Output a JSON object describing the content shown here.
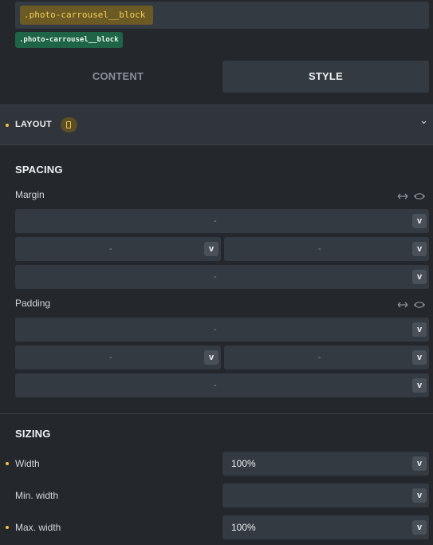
{
  "selector": {
    "chip_label": ".photo-carrousel__block",
    "class_tag": ".photo-carrousel__block"
  },
  "tabs": [
    {
      "label": "CONTENT",
      "active": false
    },
    {
      "label": "STYLE",
      "active": true
    }
  ],
  "layout": {
    "title": "LAYOUT",
    "badge_icon": "mobile-icon"
  },
  "spacing": {
    "title": "SPACING",
    "margin": {
      "label": "Margin",
      "top": "-",
      "left": "-",
      "right": "-",
      "bottom": "-",
      "unit": "v"
    },
    "padding": {
      "label": "Padding",
      "top": "-",
      "left": "-",
      "right": "-",
      "bottom": "-",
      "unit": "v"
    }
  },
  "sizing": {
    "title": "SIZING",
    "width": {
      "label": "Width",
      "value": "100%",
      "unit": "v"
    },
    "min_width": {
      "label": "Min. width",
      "value": "",
      "unit": "v"
    },
    "max_width": {
      "label": "Max. width",
      "value": "100%",
      "unit": "v"
    }
  },
  "colors": {
    "background": "#24282d",
    "input": "#343a41",
    "accent_yellow": "#f3c43c",
    "class_tag_green": "#1f6447"
  }
}
